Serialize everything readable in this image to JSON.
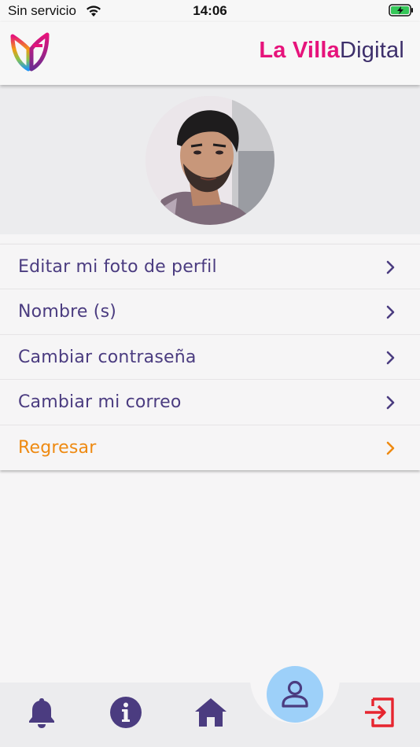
{
  "status_bar": {
    "carrier": "Sin servicio",
    "time": "14:06"
  },
  "header": {
    "brand_part1": "La Villa",
    "brand_part2": "Digital",
    "brand_colors": {
      "accent": "#e6137b",
      "dark": "#3d2f6b"
    }
  },
  "profile": {
    "photo_alt": "Foto de perfil"
  },
  "menu": {
    "items": [
      {
        "label": "Editar mi foto de perfil"
      },
      {
        "label": "Nombre (s)"
      },
      {
        "label": "Cambiar contraseña"
      },
      {
        "label": "Cambiar mi correo"
      },
      {
        "label": "Regresar"
      }
    ],
    "text_color": "#4b3c80",
    "back_color": "#ee8a12"
  },
  "bottom_nav": {
    "items": [
      {
        "icon": "bell-icon"
      },
      {
        "icon": "info-icon"
      },
      {
        "icon": "home-icon"
      },
      {
        "icon": "profile-icon",
        "active": true
      },
      {
        "icon": "logout-icon",
        "color": "#e6252f"
      }
    ]
  }
}
